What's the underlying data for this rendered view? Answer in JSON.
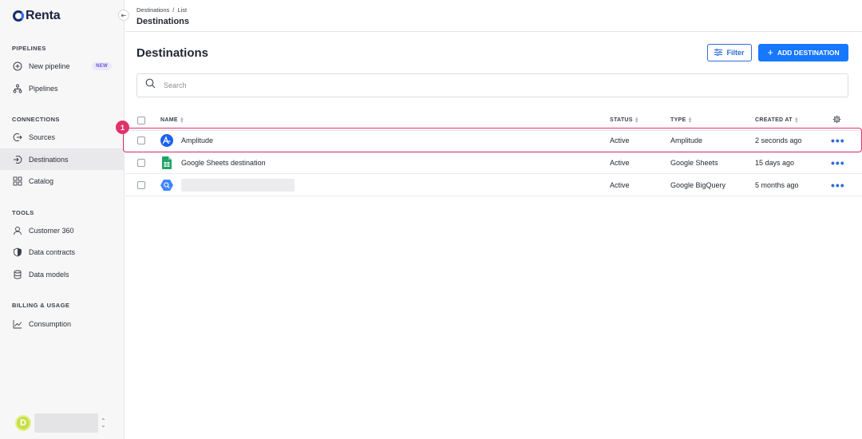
{
  "brand": {
    "name": "Renta"
  },
  "sidebar": {
    "collapse_glyph": "⇤",
    "sections": [
      {
        "title": "PIPELINES",
        "items": [
          {
            "label": "New pipeline",
            "badge": "NEW",
            "icon": "plus-circle-icon"
          },
          {
            "label": "Pipelines",
            "icon": "hierarchy-icon"
          }
        ]
      },
      {
        "title": "CONNECTIONS",
        "items": [
          {
            "label": "Sources",
            "icon": "source-icon"
          },
          {
            "label": "Destinations",
            "icon": "destination-icon",
            "active": true
          },
          {
            "label": "Catalog",
            "icon": "grid-icon"
          }
        ]
      },
      {
        "title": "TOOLS",
        "items": [
          {
            "label": "Customer 360",
            "icon": "user-icon"
          },
          {
            "label": "Data contracts",
            "icon": "shield-icon"
          },
          {
            "label": "Data models",
            "icon": "database-icon"
          }
        ]
      },
      {
        "title": "BILLING & USAGE",
        "items": [
          {
            "label": "Consumption",
            "icon": "chart-icon"
          }
        ]
      }
    ],
    "user": {
      "initial": "D"
    }
  },
  "topbar": {
    "breadcrumb": [
      "Destinations",
      "List"
    ],
    "breadcrumb_sep": "/",
    "title": "Destinations"
  },
  "main": {
    "title": "Destinations",
    "filter_label": "Filter",
    "add_label": "ADD DESTINATION",
    "search_placeholder": "Search",
    "columns": {
      "name": "NAME",
      "status": "STATUS",
      "type": "TYPE",
      "created": "CREATED AT"
    },
    "rows": [
      {
        "name": "Amplitude",
        "status": "Active",
        "type": "Amplitude",
        "created": "2 seconds ago",
        "icon": "amplitude-icon"
      },
      {
        "name": "Google Sheets destination",
        "status": "Active",
        "type": "Google Sheets",
        "created": "15 days ago",
        "icon": "google-sheets-icon"
      },
      {
        "name": "",
        "status": "Active",
        "type": "Google BigQuery",
        "created": "5 months ago",
        "icon": "bigquery-icon"
      }
    ],
    "more_glyph": "•••"
  },
  "annotation": {
    "marker": "1"
  },
  "colors": {
    "accent": "#1677ff",
    "highlight": "#e0336a"
  }
}
